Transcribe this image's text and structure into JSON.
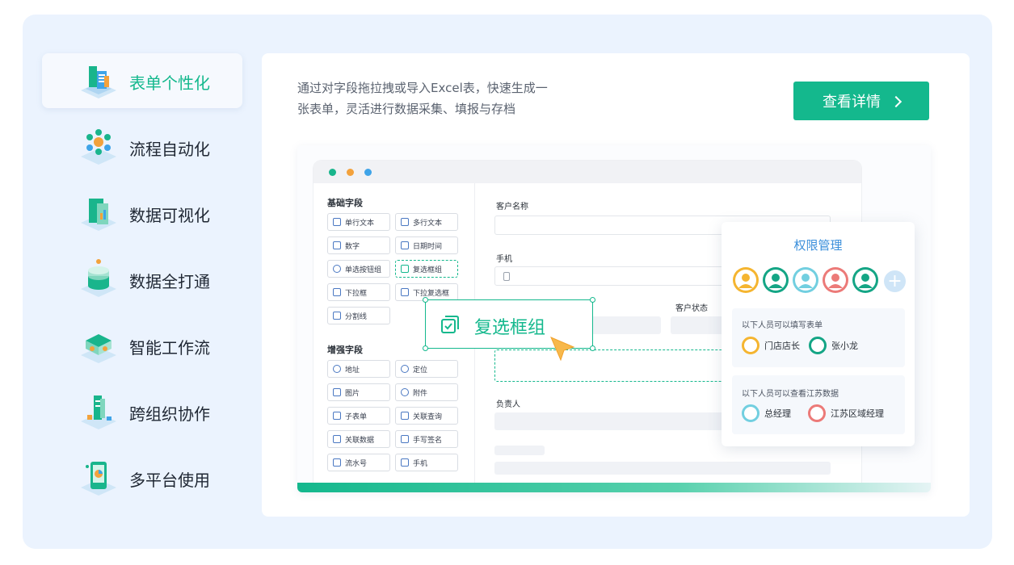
{
  "sidebar": {
    "items": [
      {
        "label": "表单个性化",
        "icon": "form-personalization-icon",
        "active": true
      },
      {
        "label": "流程自动化",
        "icon": "process-automation-icon",
        "active": false
      },
      {
        "label": "数据可视化",
        "icon": "data-visualization-icon",
        "active": false
      },
      {
        "label": "数据全打通",
        "icon": "data-integration-icon",
        "active": false
      },
      {
        "label": "智能工作流",
        "icon": "smart-workflow-icon",
        "active": false
      },
      {
        "label": "跨组织协作",
        "icon": "cross-org-collaboration-icon",
        "active": false
      },
      {
        "label": "多平台使用",
        "icon": "multi-platform-icon",
        "active": false
      }
    ]
  },
  "main": {
    "description_line1": "通过对字段拖拉拽或导入Excel表，快速生成一",
    "description_line2": "张表单，灵活进行数据采集、填报与存档",
    "cta_label": "查看详情"
  },
  "mock": {
    "basic_section": "基础字段",
    "enhanced_section": "增强字段",
    "basic_fields": [
      "单行文本",
      "多行文本",
      "数字",
      "日期时间",
      "单选按钮组",
      "复选框组",
      "下拉框",
      "下拉复选框",
      "分割线"
    ],
    "enhanced_fields": [
      "地址",
      "定位",
      "图片",
      "附件",
      "子表单",
      "关联查询",
      "关联数据",
      "手写签名",
      "流水号",
      "手机"
    ],
    "form_labels": {
      "customer_name": "客户名称",
      "phone": "手机",
      "customer_status": "客户状态",
      "owner": "负责人"
    },
    "dragged_component": "复选框组"
  },
  "permissions": {
    "title": "权限管理",
    "fill_section": "以下人员可以填写表单",
    "fill_people": [
      "门店店长",
      "张小龙"
    ],
    "view_section": "以下人员可以查看江苏数据",
    "view_people": [
      "总经理",
      "江苏区域经理"
    ]
  },
  "colors": {
    "accent": "#14b88d",
    "blue": "#3b8fdb",
    "bg": "#ebf3fe"
  }
}
